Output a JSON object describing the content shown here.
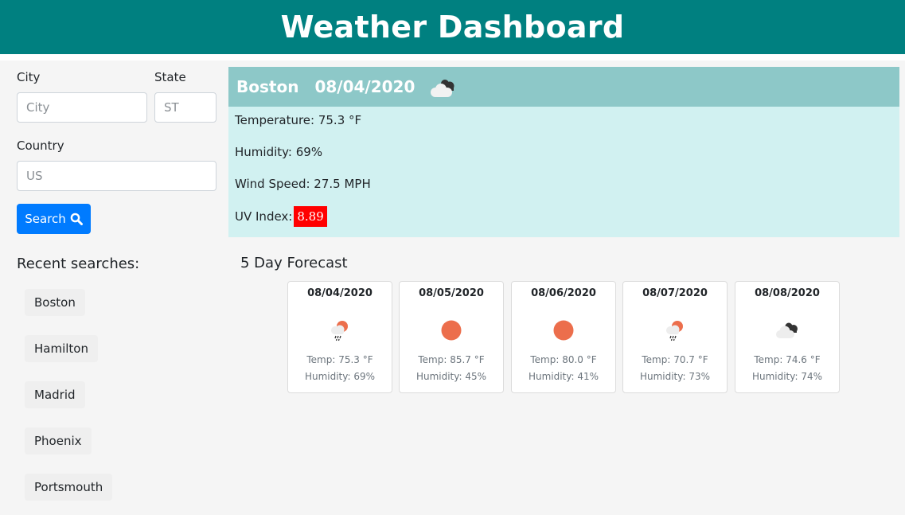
{
  "header": {
    "title": "Weather Dashboard"
  },
  "form": {
    "city_label": "City",
    "city_placeholder": "City",
    "state_label": "State",
    "state_placeholder": "ST",
    "country_label": "Country",
    "country_placeholder": "US",
    "search_label": "Search"
  },
  "recent": {
    "title": "Recent searches:",
    "items": [
      "Boston",
      "Hamilton",
      "Madrid",
      "Phoenix",
      "Portsmouth"
    ]
  },
  "current": {
    "city": "Boston",
    "date": "08/04/2020",
    "icon": "partly-cloudy-icon",
    "temperature": "Temperature: 75.3 °F",
    "humidity": "Humidity: 69%",
    "wind": "Wind Speed: 27.5 MPH",
    "uv_label": "UV Index:",
    "uv_value": "8.89"
  },
  "forecast": {
    "title": "5 Day Forecast",
    "days": [
      {
        "date": "08/04/2020",
        "icon": "rain-sun-icon",
        "temp": "Temp: 75.3 °F",
        "humidity": "Humidity: 69%"
      },
      {
        "date": "08/05/2020",
        "icon": "sun-icon",
        "temp": "Temp: 85.7 °F",
        "humidity": "Humidity: 45%"
      },
      {
        "date": "08/06/2020",
        "icon": "sun-icon",
        "temp": "Temp: 80.0 °F",
        "humidity": "Humidity: 41%"
      },
      {
        "date": "08/07/2020",
        "icon": "rain-sun-icon",
        "temp": "Temp: 70.7 °F",
        "humidity": "Humidity: 73%"
      },
      {
        "date": "08/08/2020",
        "icon": "cloudy-icon",
        "temp": "Temp: 74.6 °F",
        "humidity": "Humidity: 74%"
      }
    ]
  },
  "colors": {
    "header": "#008080",
    "current_header": "#8dc8c8",
    "current_body": "#d1f1f1",
    "search_button": "#007bff",
    "uv_badge": "#ff0000",
    "sun": "#ec6e4c"
  }
}
